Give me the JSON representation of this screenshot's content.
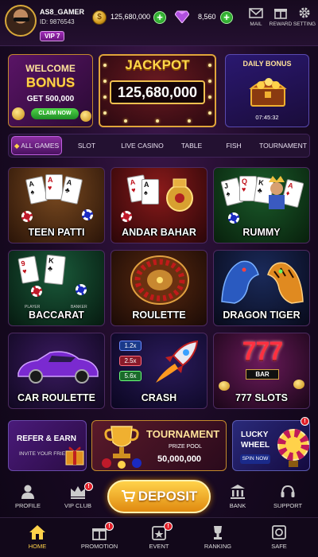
{
  "profile": {
    "username": "AS8_GAMER",
    "id": "ID: 9876543",
    "vip": "VIP 7"
  },
  "wallet": {
    "coins": "125,680,000",
    "gems": "8,560"
  },
  "top_actions": [
    {
      "label": "MAIL",
      "icon": "mail-icon"
    },
    {
      "label": "REWARD",
      "icon": "gift-icon"
    },
    {
      "label": "SETTING",
      "icon": "gear-icon"
    }
  ],
  "promos": {
    "welcome": {
      "line1": "WELCOME",
      "line2": "BONUS",
      "line3": "GET 500,000",
      "button": "CLAIM NOW"
    },
    "jackpot": {
      "title": "JACKPOT",
      "value": "125,680,000"
    },
    "daily": {
      "title": "DAILY BONUS",
      "timer": "07:45:32"
    }
  },
  "tabs": [
    "ALL GAMES",
    "SLOT",
    "LIVE CASINO",
    "TABLE",
    "FISH",
    "TOURNAMENT"
  ],
  "games": [
    {
      "name": "TEEN PATTI"
    },
    {
      "name": "ANDAR BAHAR"
    },
    {
      "name": "RUMMY"
    },
    {
      "name": "BACCARAT"
    },
    {
      "name": "ROULETTE"
    },
    {
      "name": "DRAGON TIGER"
    },
    {
      "name": "CAR ROULETTE"
    },
    {
      "name": "CRASH"
    },
    {
      "name": "777 SLOTS"
    }
  ],
  "crash_multipliers": [
    "1.2x",
    "2.5x",
    "5.6x"
  ],
  "slot_art": {
    "sevens": "777",
    "bar": "BAR"
  },
  "baccarat_table": {
    "player": "PLAYER",
    "banker": "BANKER"
  },
  "bottom_promos": {
    "refer": {
      "title": "REFER & EARN",
      "subtitle": "INVITE YOUR FRIEND"
    },
    "tournament": {
      "title": "TOURNAMENT",
      "subtitle": "PRIZE POOL",
      "value": "50,000,000"
    },
    "lucky": {
      "title": "LUCKY WHEEL",
      "button": "SPIN NOW",
      "badge": "!"
    }
  },
  "nav_upper": [
    {
      "label": "PROFILE"
    },
    {
      "label": "VIP CLUB",
      "badge": "!"
    },
    {
      "label": "BANK"
    },
    {
      "label": "SUPPORT"
    }
  ],
  "deposit_label": "DEPOSIT",
  "nav_lower": [
    {
      "label": "HOME"
    },
    {
      "label": "PROMOTION",
      "badge": "!"
    },
    {
      "label": "EVENT",
      "badge": "!"
    },
    {
      "label": "RANKING"
    },
    {
      "label": "SAFE"
    }
  ],
  "colors": {
    "gold": "#ffd24a",
    "purple": "#8a2ea0",
    "green": "#1d8d24",
    "bg": "#1a0a24"
  }
}
